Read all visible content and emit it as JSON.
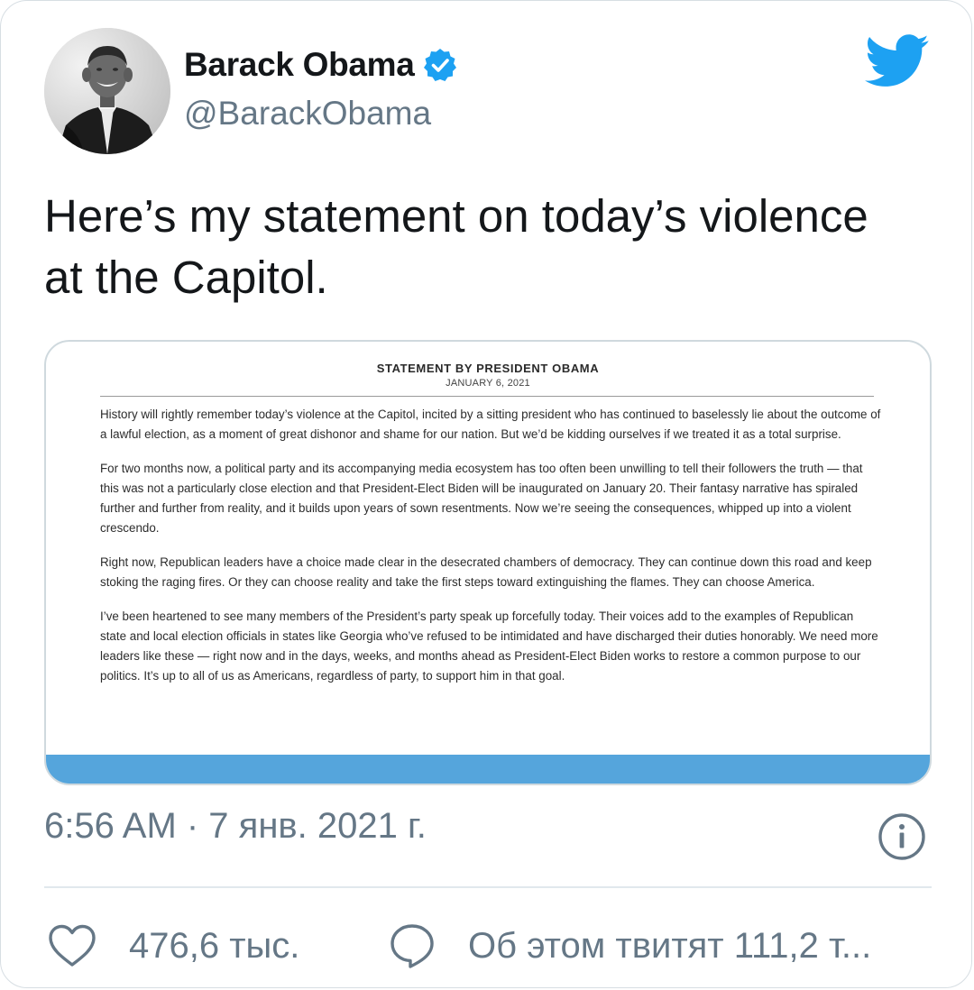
{
  "user": {
    "display_name": "Barack Obama",
    "handle": "@BarackObama",
    "verified": true,
    "avatar_icon": "profile-photo"
  },
  "brand": {
    "icon": "twitter-bird-icon",
    "color": "#1da1f2"
  },
  "tweet": {
    "text": "Here’s my statement on today’s violence at the Capitol.",
    "timestamp": "6:56 AM · 7 янв. 2021 г."
  },
  "statement": {
    "title": "STATEMENT BY PRESIDENT OBAMA",
    "date": "JANUARY 6, 2021",
    "paragraphs": [
      "History will rightly remember today’s violence at the Capitol, incited by a sitting president who has continued to baselessly lie about the outcome of a lawful election, as a moment of great dishonor and shame for our nation. But we’d be kidding ourselves if we treated it as a total surprise.",
      "For two months now, a political party and its accompanying media ecosystem has too often been unwilling to tell their followers the truth — that this was not a particularly close election and that President-Elect Biden will be inaugurated on January 20. Their fantasy narrative has spiraled further and further from reality, and it builds upon years of sown resentments. Now we’re seeing the consequences, whipped up into a violent crescendo.",
      "Right now, Republican leaders have a choice made clear in the desecrated chambers of democracy. They can continue down this road and keep stoking the raging fires. Or they can choose reality and take the first steps toward extinguishing the flames. They can choose America.",
      "I’ve been heartened to see many members of the President’s party speak up forcefully today. Their voices add to the examples of Republican state and local election officials in states like Georgia who’ve refused to be intimidated and have discharged their duties honorably. We need more leaders like these — right now and in the days, weeks, and months ahead as President-Elect Biden works to restore a common purpose to our politics. It’s up to all of us as Americans, regardless of party, to support him in that goal."
    ],
    "band_color": "#55a5dc"
  },
  "actions": {
    "likes": "476,6 тыс.",
    "retweets": "Об этом твитят 111,2 т..."
  }
}
